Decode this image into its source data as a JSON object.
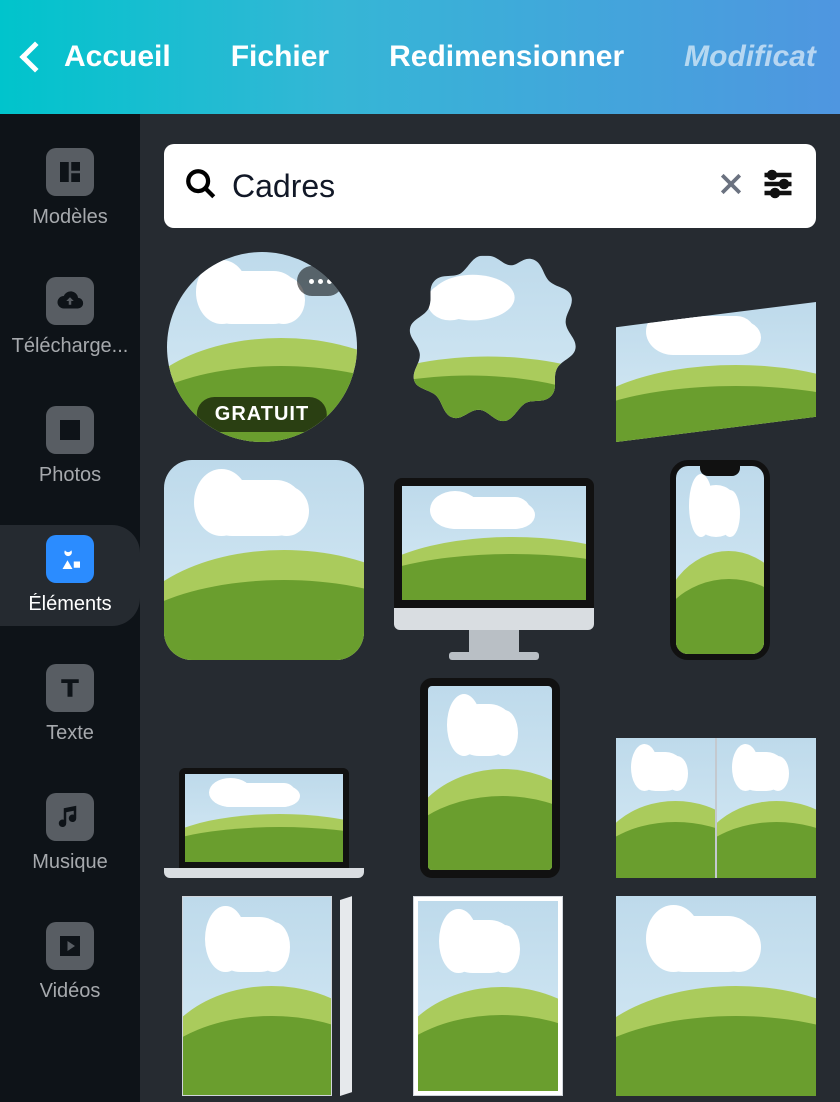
{
  "topbar": {
    "home": "Accueil",
    "file": "Fichier",
    "resize": "Redimensionner",
    "edit": "Modificat"
  },
  "sidebar": {
    "items": [
      {
        "label": "Modèles"
      },
      {
        "label": "Télécharge..."
      },
      {
        "label": "Photos"
      },
      {
        "label": "Éléments"
      },
      {
        "label": "Texte"
      },
      {
        "label": "Musique"
      },
      {
        "label": "Vidéos"
      }
    ]
  },
  "search": {
    "value": "Cadres"
  },
  "badge": {
    "free": "GRATUIT"
  }
}
